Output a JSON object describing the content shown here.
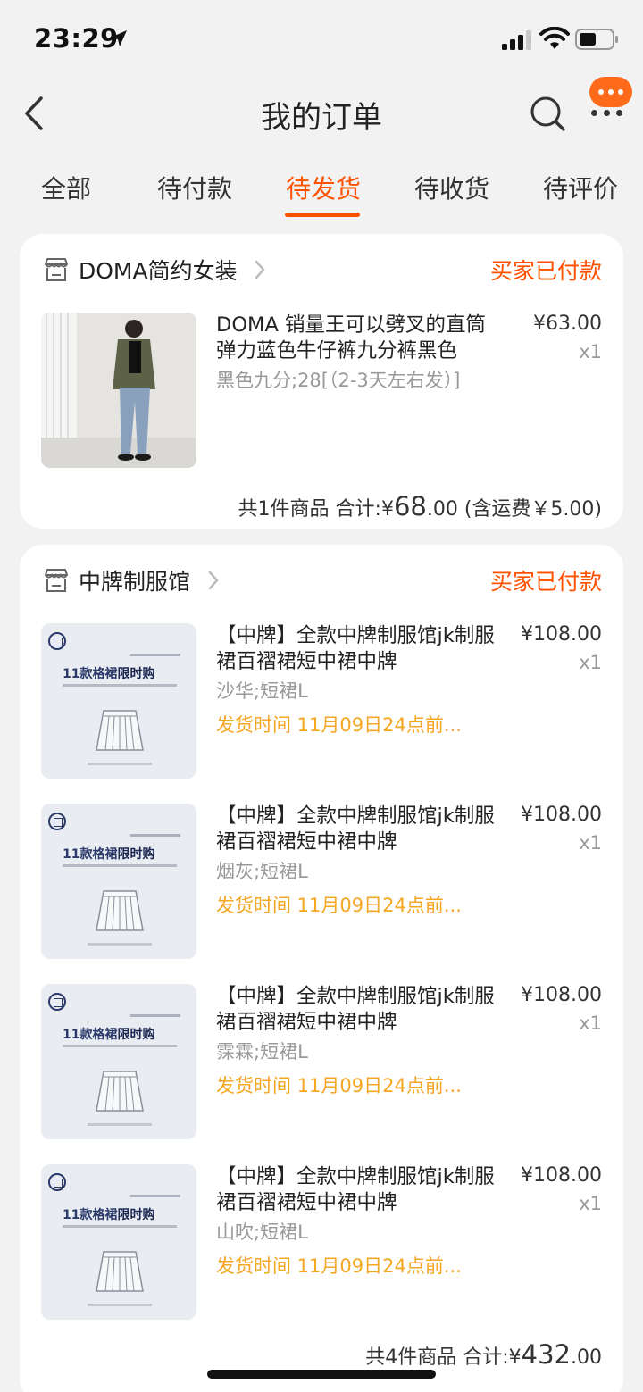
{
  "status_bar": {
    "time": "23:29",
    "icons": [
      "location-arrow-icon",
      "signal-icon",
      "wifi-icon",
      "battery-icon"
    ]
  },
  "nav": {
    "title": "我的订单",
    "icons": [
      "back-icon",
      "search-icon",
      "message-icon",
      "more-icon"
    ]
  },
  "tabs": [
    {
      "label": "全部",
      "active": false
    },
    {
      "label": "待付款",
      "active": false
    },
    {
      "label": "待发货",
      "active": true
    },
    {
      "label": "待收货",
      "active": false
    },
    {
      "label": "待评价",
      "active": false
    }
  ],
  "orders": [
    {
      "shop_name": "DOMA简约女装",
      "status": "买家已付款",
      "items": [
        {
          "title": "DOMA 销量王可以劈叉的直筒弹力蓝色牛仔裤九分裤黑色",
          "sku": "黑色九分;28[（2-3天左右发）]",
          "price": "¥63.00",
          "qty": "x1"
        }
      ],
      "summary": {
        "count": "共1件商品",
        "total_label": "合计:",
        "currency": "¥",
        "total_int": "68",
        "total_dec": ".00",
        "shipping": "(含运费￥5.00)"
      }
    },
    {
      "shop_name": "中牌制服馆",
      "status": "买家已付款",
      "items": [
        {
          "title": "【中牌】全款中牌制服馆jk制服裙百褶裙短中裙中牌",
          "sku": "沙华;短裙L",
          "ship_time": "发货时间 11月09日24点前...",
          "price": "¥108.00",
          "qty": "x1",
          "thumb_text": [
            "11款格裙",
            "限时购"
          ]
        },
        {
          "title": "【中牌】全款中牌制服馆jk制服裙百褶裙短中裙中牌",
          "sku": "烟灰;短裙L",
          "ship_time": "发货时间 11月09日24点前...",
          "price": "¥108.00",
          "qty": "x1",
          "thumb_text": [
            "11款格裙",
            "限时购"
          ]
        },
        {
          "title": "【中牌】全款中牌制服馆jk制服裙百褶裙短中裙中牌",
          "sku": "霂霖;短裙L",
          "ship_time": "发货时间 11月09日24点前...",
          "price": "¥108.00",
          "qty": "x1",
          "thumb_text": [
            "11款格裙",
            "限时购"
          ]
        },
        {
          "title": "【中牌】全款中牌制服馆jk制服裙百褶裙短中裙中牌",
          "sku": "山吹;短裙L",
          "ship_time": "发货时间 11月09日24点前...",
          "price": "¥108.00",
          "qty": "x1",
          "thumb_text": [
            "11款格裙",
            "限时购"
          ]
        }
      ],
      "summary": {
        "count": "共4件商品",
        "total_label": "合计:",
        "currency": "¥",
        "total_int": "432",
        "total_dec": ".00"
      }
    }
  ],
  "colors": {
    "accent": "#ff5000",
    "ship_time": "#f5a623",
    "background": "#f2f2f2"
  }
}
